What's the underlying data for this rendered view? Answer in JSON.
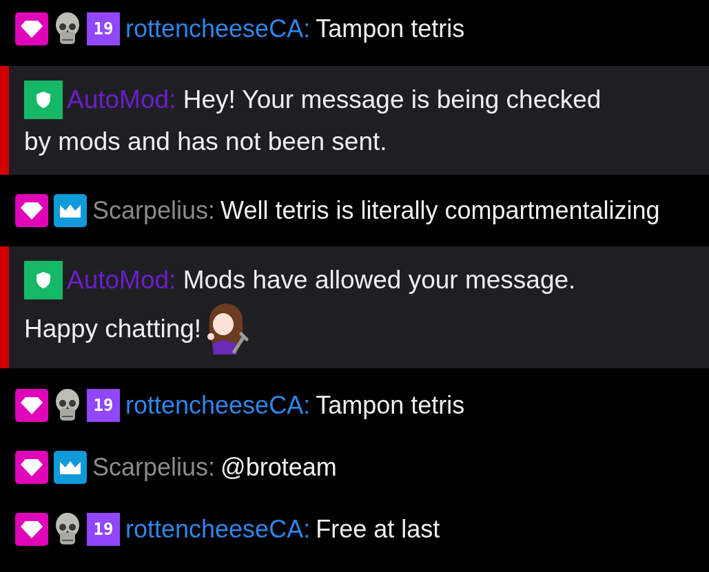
{
  "messages": [
    {
      "kind": "chat",
      "badges": [
        {
          "kind": "gem"
        },
        {
          "kind": "skull"
        },
        {
          "kind": "number",
          "text": "19"
        }
      ],
      "username": "rottencheeseCA:",
      "color": "#2e86e8",
      "text": "Tampon tetris"
    },
    {
      "kind": "automod",
      "username": "AutoMod:",
      "lines": [
        "Hey! Your message is being checked",
        "by mods and has not been sent."
      ],
      "emote": false
    },
    {
      "kind": "chat",
      "badges": [
        {
          "kind": "gem"
        },
        {
          "kind": "crown"
        }
      ],
      "username": "Scarpelius:",
      "color": "#8a8a8a",
      "text": "Well tetris is literally compartmentalizing"
    },
    {
      "kind": "automod",
      "username": "AutoMod:",
      "lines": [
        "Mods have allowed your message.",
        "Happy chatting!"
      ],
      "emote": true
    },
    {
      "kind": "chat",
      "badges": [
        {
          "kind": "gem"
        },
        {
          "kind": "skull"
        },
        {
          "kind": "number",
          "text": "19"
        }
      ],
      "username": "rottencheeseCA:",
      "color": "#2e86e8",
      "text": "Tampon tetris"
    },
    {
      "kind": "chat",
      "badges": [
        {
          "kind": "gem"
        },
        {
          "kind": "crown"
        }
      ],
      "username": "Scarpelius:",
      "color": "#8a8a8a",
      "text": "@broteam"
    },
    {
      "kind": "chat",
      "badges": [
        {
          "kind": "gem"
        },
        {
          "kind": "skull"
        },
        {
          "kind": "number",
          "text": "19"
        }
      ],
      "username": "rottencheeseCA:",
      "color": "#2e86e8",
      "text": "Free at last"
    }
  ]
}
